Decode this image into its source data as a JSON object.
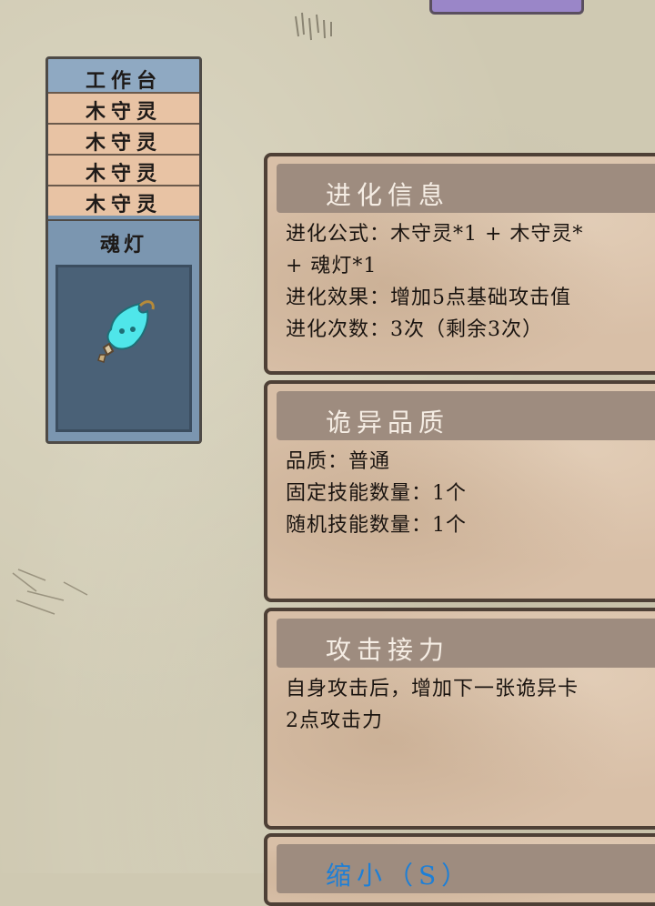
{
  "card_stack": {
    "top_label": "工作台",
    "layers": [
      "木守灵",
      "木守灵",
      "木守灵",
      "木守灵"
    ],
    "main_card": {
      "name": "魂灯",
      "icon": "soul-lamp-icon"
    }
  },
  "panels": {
    "evolution": {
      "title": "进化信息",
      "lines": [
        "进化公式：木守灵*1 + 木守灵*",
        "+ 魂灯*1",
        "进化效果：增加5点基础攻击值",
        "进化次数：3次（剩余3次）"
      ]
    },
    "quality": {
      "title": "诡异品质",
      "lines": [
        "品质：普通",
        "固定技能数量：1个",
        "随机技能数量：1个"
      ]
    },
    "skill": {
      "title": "攻击接力",
      "lines": [
        "自身攻击后，增加下一张诡异卡",
        "2点攻击力"
      ]
    },
    "size": {
      "title": "缩小（S）"
    }
  },
  "colors": {
    "card_blue": "#7b96b0",
    "card_peach": "#e8c3a4",
    "panel_bg": "#d8bfa7",
    "header_bar": "#9e8c7f",
    "title_blue": "#1e7fd6"
  }
}
